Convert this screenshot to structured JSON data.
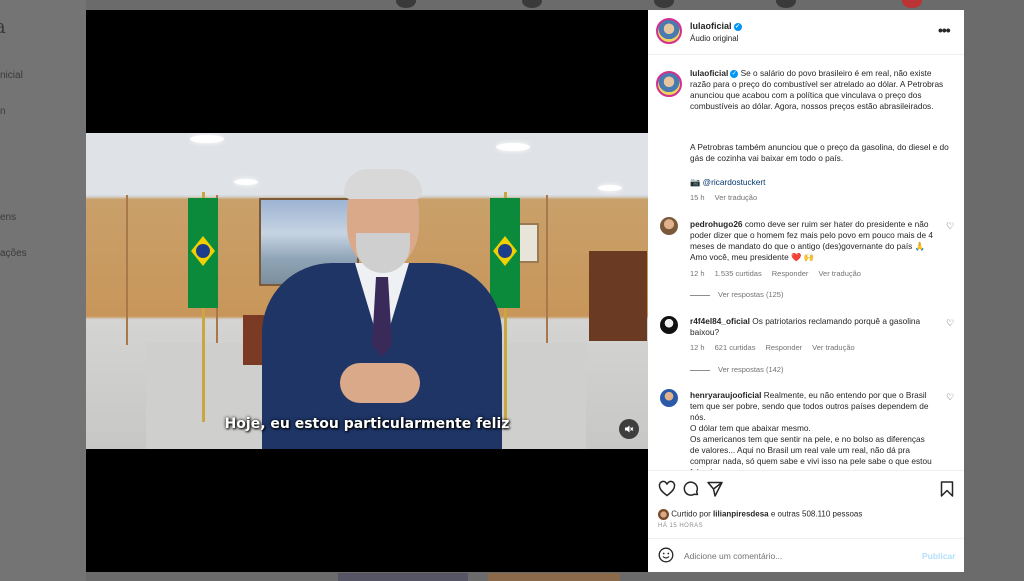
{
  "backdrop": {
    "logo": "a",
    "nav": [
      "nicial",
      "n",
      "ens",
      "ações"
    ]
  },
  "video": {
    "subtitle": "Hoje, eu estou particularmente feliz",
    "mute_icon": "speaker-muted-icon"
  },
  "header": {
    "username": "lulaoficial",
    "subtitle": "Áudio original",
    "more_label": "•••"
  },
  "caption": {
    "username": "lulaoficial",
    "paragraph1": "Se o salário do povo brasileiro é em real, não existe razão para o preço do combustível ser atrelado ao dólar. A Petrobras anunciou que acabou com a política que vinculava o preço dos combustíveis ao dólar. Agora, nossos preços estão abrasileirados.",
    "paragraph2": "A Petrobras também anunciou que o preço da gasolina, do diesel e do gás de cozinha vai baixar em todo o país.",
    "credit_icon": "📷",
    "credit": "@ricardostuckert",
    "time": "15 h",
    "translate": "Ver tradução"
  },
  "comments": [
    {
      "username": "pedrohugo26",
      "text": "como deve ser ruim ser hater do presidente e não poder dizer que o homem fez mais pelo povo em pouco mais de 4 meses de mandato do que o antigo (des)governante do país 🙏 Amo você, meu presidente ❤️ 🙌",
      "time": "12 h",
      "likes": "1.535 curtidas",
      "reply": "Responder",
      "translate": "Ver tradução",
      "replies": "Ver respostas (125)"
    },
    {
      "username": "r4f4el84_oficial",
      "text": "Os patriotarios reclamando porquê a gasolina baixou?",
      "time": "12 h",
      "likes": "621 curtidas",
      "reply": "Responder",
      "translate": "Ver tradução",
      "replies": "Ver respostas (142)"
    },
    {
      "username": "henryaraujooficial",
      "text": "Realmente, eu não entendo por que o Brasil tem que ser pobre, sendo que todos outros países dependem de nós.",
      "text2": "O dólar tem que abaixar mesmo.",
      "text3": "Os americanos tem que sentir na pele, e no bolso as diferenças de valores... Aqui no Brasil um real vale um real, não dá pra comprar nada, só quem sabe e vivi isso na pele sabe o que estou falando..."
    }
  ],
  "actions": {
    "liked_prefix": "Curtido por",
    "liked_user": "lilianpiresdesa",
    "liked_suffix": "e outras 508.110 pessoas",
    "time": "HÁ 15 HORAS"
  },
  "comment_box": {
    "placeholder": "Adicione um comentário...",
    "publish": "Publicar"
  },
  "colors": {
    "accent": "#0095f6",
    "publish_disabled": "#b2dffc",
    "flag_green": "#0b8a3b",
    "flag_yellow": "#f0d000"
  }
}
